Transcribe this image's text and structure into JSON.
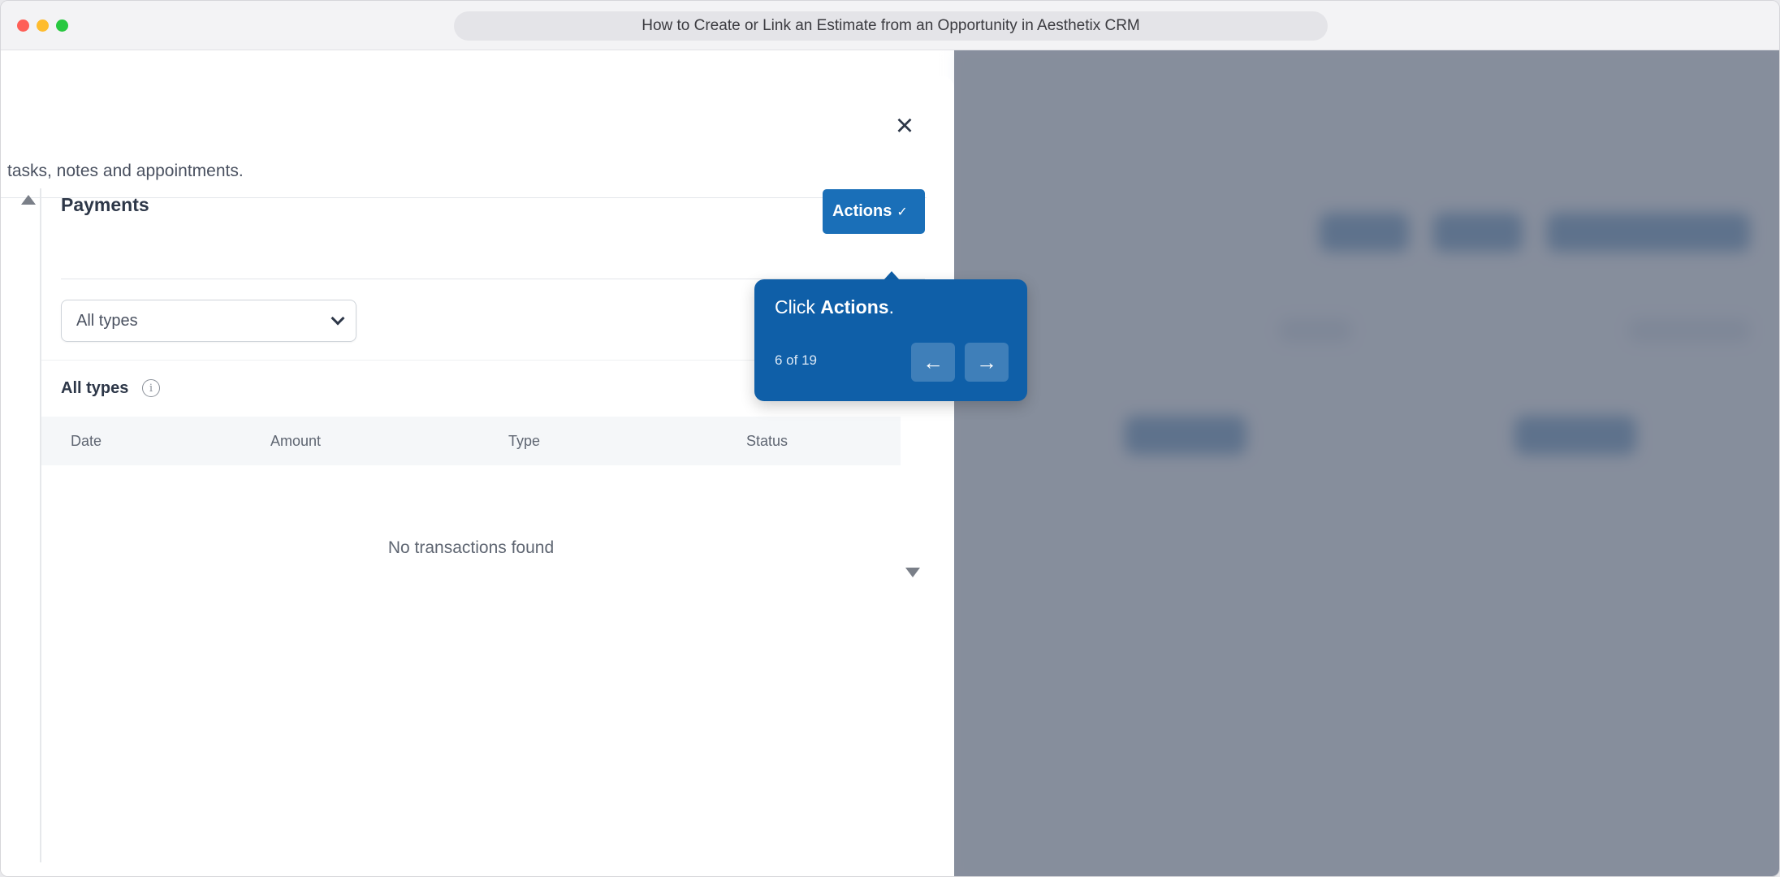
{
  "window": {
    "title": "How to Create or Link an Estimate from an Opportunity in Aesthetix CRM"
  },
  "drawer": {
    "subtitle": "tasks, notes and appointments.",
    "close_icon": "×",
    "section_title": "Payments",
    "actions_label": "Actions",
    "actions_chevron": "✓",
    "filter": {
      "selected": "All types"
    },
    "types_label": "All types",
    "info_icon": "i",
    "table": {
      "columns": [
        "Date",
        "Amount",
        "Type",
        "Status"
      ],
      "empty_message": "No transactions found"
    }
  },
  "tooltip": {
    "prefix": "Click ",
    "target": "Actions",
    "suffix": ".",
    "step": "6 of 19",
    "prev_icon": "←",
    "next_icon": "→"
  },
  "colors": {
    "primary": "#1a6fb8",
    "tooltip_bg": "#0f5fa8",
    "overlay": "#6e7687"
  }
}
